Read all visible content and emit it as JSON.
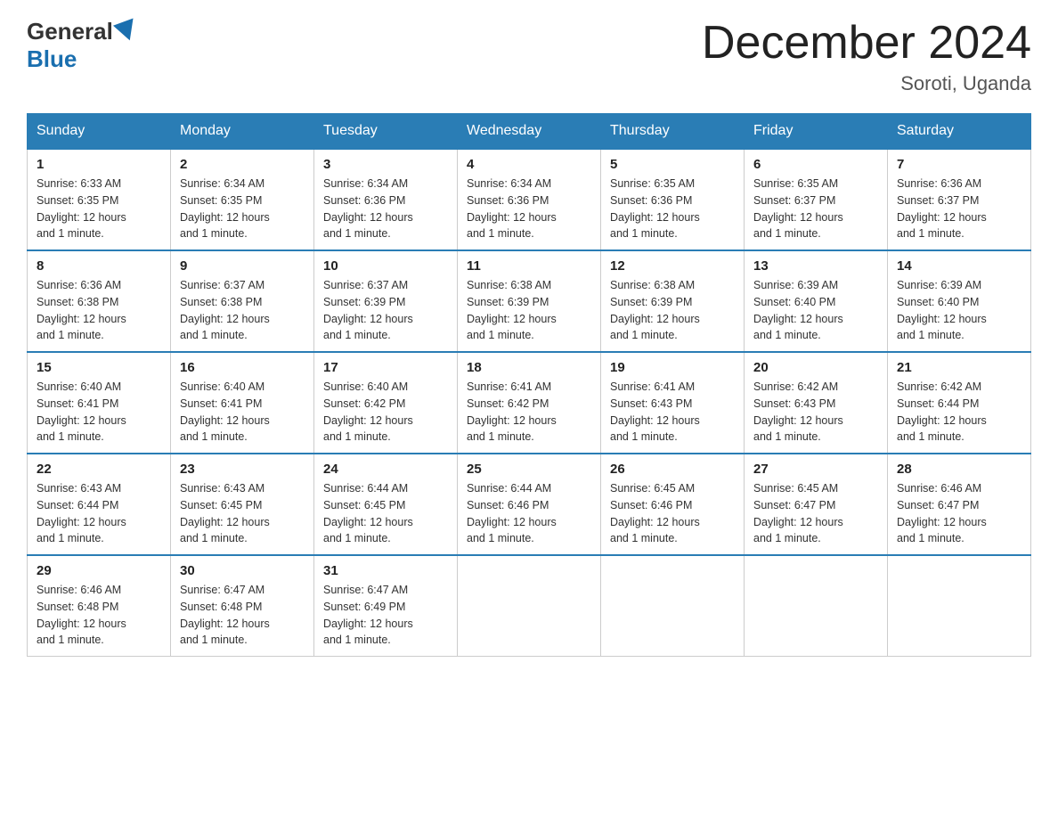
{
  "header": {
    "logo": {
      "general": "General",
      "blue": "Blue"
    },
    "title": "December 2024",
    "location": "Soroti, Uganda"
  },
  "days_of_week": [
    "Sunday",
    "Monday",
    "Tuesday",
    "Wednesday",
    "Thursday",
    "Friday",
    "Saturday"
  ],
  "weeks": [
    [
      {
        "day": "1",
        "sunrise": "6:33 AM",
        "sunset": "6:35 PM",
        "daylight": "12 hours and 1 minute."
      },
      {
        "day": "2",
        "sunrise": "6:34 AM",
        "sunset": "6:35 PM",
        "daylight": "12 hours and 1 minute."
      },
      {
        "day": "3",
        "sunrise": "6:34 AM",
        "sunset": "6:36 PM",
        "daylight": "12 hours and 1 minute."
      },
      {
        "day": "4",
        "sunrise": "6:34 AM",
        "sunset": "6:36 PM",
        "daylight": "12 hours and 1 minute."
      },
      {
        "day": "5",
        "sunrise": "6:35 AM",
        "sunset": "6:36 PM",
        "daylight": "12 hours and 1 minute."
      },
      {
        "day": "6",
        "sunrise": "6:35 AM",
        "sunset": "6:37 PM",
        "daylight": "12 hours and 1 minute."
      },
      {
        "day": "7",
        "sunrise": "6:36 AM",
        "sunset": "6:37 PM",
        "daylight": "12 hours and 1 minute."
      }
    ],
    [
      {
        "day": "8",
        "sunrise": "6:36 AM",
        "sunset": "6:38 PM",
        "daylight": "12 hours and 1 minute."
      },
      {
        "day": "9",
        "sunrise": "6:37 AM",
        "sunset": "6:38 PM",
        "daylight": "12 hours and 1 minute."
      },
      {
        "day": "10",
        "sunrise": "6:37 AM",
        "sunset": "6:39 PM",
        "daylight": "12 hours and 1 minute."
      },
      {
        "day": "11",
        "sunrise": "6:38 AM",
        "sunset": "6:39 PM",
        "daylight": "12 hours and 1 minute."
      },
      {
        "day": "12",
        "sunrise": "6:38 AM",
        "sunset": "6:39 PM",
        "daylight": "12 hours and 1 minute."
      },
      {
        "day": "13",
        "sunrise": "6:39 AM",
        "sunset": "6:40 PM",
        "daylight": "12 hours and 1 minute."
      },
      {
        "day": "14",
        "sunrise": "6:39 AM",
        "sunset": "6:40 PM",
        "daylight": "12 hours and 1 minute."
      }
    ],
    [
      {
        "day": "15",
        "sunrise": "6:40 AM",
        "sunset": "6:41 PM",
        "daylight": "12 hours and 1 minute."
      },
      {
        "day": "16",
        "sunrise": "6:40 AM",
        "sunset": "6:41 PM",
        "daylight": "12 hours and 1 minute."
      },
      {
        "day": "17",
        "sunrise": "6:40 AM",
        "sunset": "6:42 PM",
        "daylight": "12 hours and 1 minute."
      },
      {
        "day": "18",
        "sunrise": "6:41 AM",
        "sunset": "6:42 PM",
        "daylight": "12 hours and 1 minute."
      },
      {
        "day": "19",
        "sunrise": "6:41 AM",
        "sunset": "6:43 PM",
        "daylight": "12 hours and 1 minute."
      },
      {
        "day": "20",
        "sunrise": "6:42 AM",
        "sunset": "6:43 PM",
        "daylight": "12 hours and 1 minute."
      },
      {
        "day": "21",
        "sunrise": "6:42 AM",
        "sunset": "6:44 PM",
        "daylight": "12 hours and 1 minute."
      }
    ],
    [
      {
        "day": "22",
        "sunrise": "6:43 AM",
        "sunset": "6:44 PM",
        "daylight": "12 hours and 1 minute."
      },
      {
        "day": "23",
        "sunrise": "6:43 AM",
        "sunset": "6:45 PM",
        "daylight": "12 hours and 1 minute."
      },
      {
        "day": "24",
        "sunrise": "6:44 AM",
        "sunset": "6:45 PM",
        "daylight": "12 hours and 1 minute."
      },
      {
        "day": "25",
        "sunrise": "6:44 AM",
        "sunset": "6:46 PM",
        "daylight": "12 hours and 1 minute."
      },
      {
        "day": "26",
        "sunrise": "6:45 AM",
        "sunset": "6:46 PM",
        "daylight": "12 hours and 1 minute."
      },
      {
        "day": "27",
        "sunrise": "6:45 AM",
        "sunset": "6:47 PM",
        "daylight": "12 hours and 1 minute."
      },
      {
        "day": "28",
        "sunrise": "6:46 AM",
        "sunset": "6:47 PM",
        "daylight": "12 hours and 1 minute."
      }
    ],
    [
      {
        "day": "29",
        "sunrise": "6:46 AM",
        "sunset": "6:48 PM",
        "daylight": "12 hours and 1 minute."
      },
      {
        "day": "30",
        "sunrise": "6:47 AM",
        "sunset": "6:48 PM",
        "daylight": "12 hours and 1 minute."
      },
      {
        "day": "31",
        "sunrise": "6:47 AM",
        "sunset": "6:49 PM",
        "daylight": "12 hours and 1 minute."
      },
      null,
      null,
      null,
      null
    ]
  ]
}
